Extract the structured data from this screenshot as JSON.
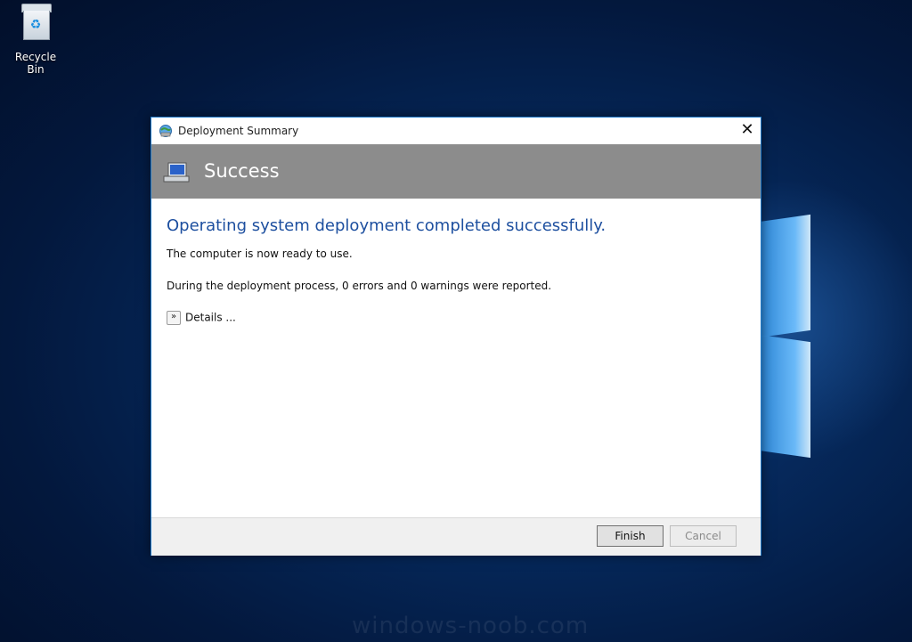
{
  "desktop": {
    "recycle_bin_label": "Recycle Bin",
    "watermark": "windows-noob.com"
  },
  "dialog": {
    "title": "Deployment Summary",
    "close_glyph": "✕",
    "banner_title": "Success",
    "heading": "Operating system deployment completed successfully.",
    "ready_text": "The computer is now ready to use.",
    "report_text": "During the deployment process, 0 errors and 0 warnings were reported.",
    "details_label": "Details ...",
    "details_glyph": "»",
    "finish_label": "Finish",
    "cancel_label": "Cancel"
  },
  "colors": {
    "heading": "#1d4f9f",
    "banner": "#8c8c8c",
    "dialog_border": "#1e79c9"
  },
  "icons": [
    "recycle-bin-icon",
    "deployment-app-icon",
    "close-icon",
    "computer-monitor-icon",
    "expand-chevron-icon"
  ]
}
